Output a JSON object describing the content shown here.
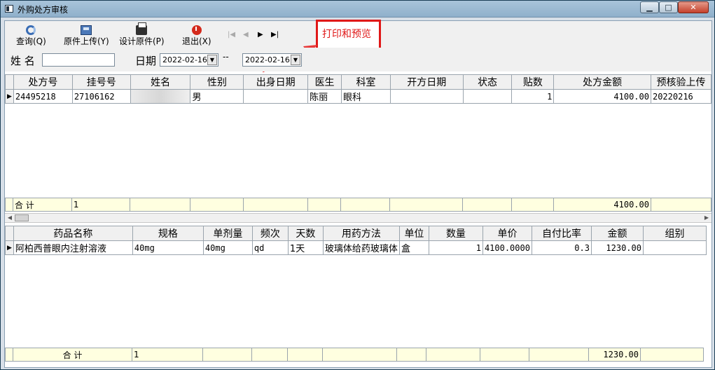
{
  "window": {
    "title": "外购处方审核"
  },
  "toolbar": {
    "query": "查询(Q)",
    "upload": "原件上传(Y)",
    "design": "设计原件(P)",
    "exit": "退出(X)",
    "nav_first": "|◀",
    "nav_prev": "◀",
    "nav_next": "▶",
    "nav_last": "▶|"
  },
  "annotation": {
    "text": "打印和预览",
    "color": "#e01818"
  },
  "filter": {
    "name_label": "姓 名",
    "name_value": "",
    "date_label": "日期",
    "date_from": "2022-02-16",
    "date_sep": "--",
    "date_to": "2022-02-16"
  },
  "rx_table": {
    "headers": [
      "处方号",
      "挂号号",
      "姓名",
      "性别",
      "出身日期",
      "医生",
      "科室",
      "开方日期",
      "状态",
      "贴数",
      "处方金额",
      "预核验上传"
    ],
    "rows": [
      [
        "24495218",
        "27106162",
        "",
        "男",
        "",
        "陈丽",
        "眼科",
        "",
        "",
        "1",
        "4100.00",
        "20220216"
      ]
    ],
    "total_label": "合 计",
    "total_count": "1",
    "total_amount": "4100.00"
  },
  "drug_table": {
    "headers": [
      "药品名称",
      "规格",
      "单剂量",
      "频次",
      "天数",
      "用药方法",
      "单位",
      "数量",
      "单价",
      "自付比率",
      "金额",
      "组别"
    ],
    "rows": [
      [
        "阿柏西普眼内注射溶液",
        "40mg",
        "40mg",
        "qd",
        "1天",
        "玻璃体给药玻璃体",
        "盒",
        "1",
        "4100.0000",
        "0.3",
        "1230.00",
        ""
      ]
    ],
    "total_label": "合 计",
    "total_count": "1",
    "total_amount": "1230.00"
  }
}
